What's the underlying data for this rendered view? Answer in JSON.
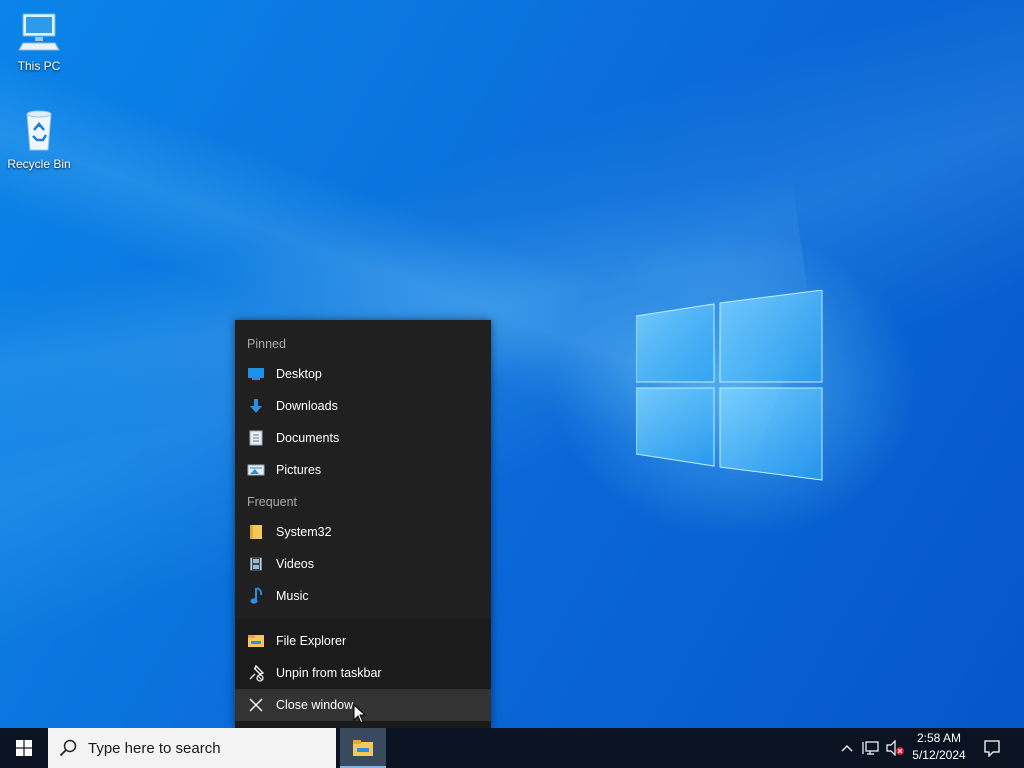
{
  "desktop": {
    "icons": [
      {
        "label": "This PC",
        "icon": "computer-icon"
      },
      {
        "label": "Recycle Bin",
        "icon": "recycle-bin-icon"
      }
    ]
  },
  "jumplist": {
    "pinned_header": "Pinned",
    "pinned": [
      {
        "label": "Desktop",
        "icon": "desktop-folder-icon"
      },
      {
        "label": "Downloads",
        "icon": "download-arrow-icon"
      },
      {
        "label": "Documents",
        "icon": "document-icon"
      },
      {
        "label": "Pictures",
        "icon": "pictures-icon"
      }
    ],
    "frequent_header": "Frequent",
    "frequent": [
      {
        "label": "System32",
        "icon": "folder-icon"
      },
      {
        "label": "Videos",
        "icon": "film-icon"
      },
      {
        "label": "Music",
        "icon": "music-note-icon"
      }
    ],
    "actions": [
      {
        "label": "File Explorer",
        "icon": "file-explorer-icon"
      },
      {
        "label": "Unpin from taskbar",
        "icon": "unpin-icon"
      },
      {
        "label": "Close window",
        "icon": "close-icon"
      }
    ]
  },
  "taskbar": {
    "search_placeholder": "Type here to search",
    "clock_time": "2:58 AM",
    "clock_date": "5/12/2024"
  },
  "colors": {
    "accent": "#0078d7",
    "jumplist_bg": "#202020",
    "taskbar_bg": "#0b1322"
  }
}
